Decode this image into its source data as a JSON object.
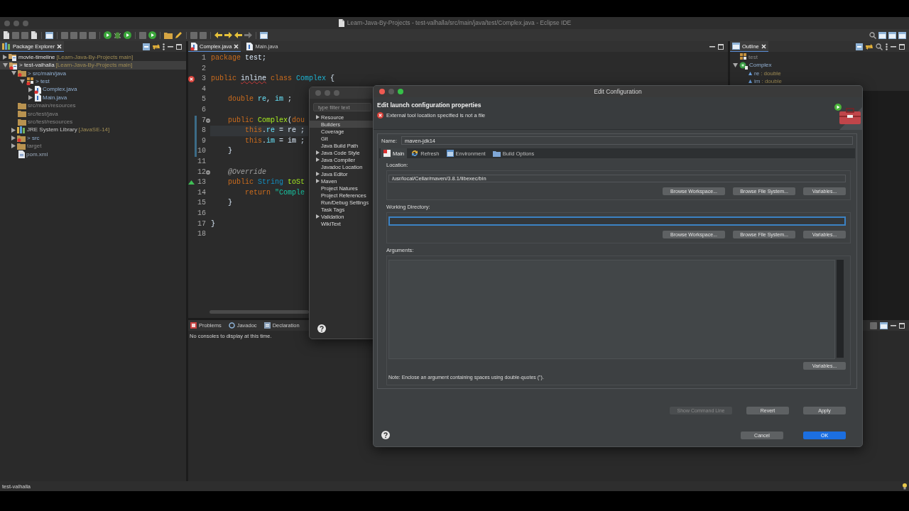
{
  "window": {
    "title": "Learn-Java-By-Projects - test-valhalla/src/main/java/test/Complex.java - Eclipse IDE"
  },
  "package_explorer": {
    "tab": {
      "label": "Package Explorer",
      "selected": true
    },
    "items": [
      {
        "label": "movie-timeline",
        "decoration": "[Learn-Java-By-Projects main]",
        "kind": "project",
        "expanded": false,
        "selected": false,
        "error": false
      },
      {
        "label": "> test-valhalla",
        "decoration": "[Learn-Java-By-Projects main]",
        "kind": "project",
        "expanded": true,
        "selected": true,
        "error": true,
        "children": [
          {
            "label": "> src/main/java",
            "kind": "source-folder",
            "expanded": true,
            "selected": false,
            "error": true,
            "children": [
              {
                "label": "> test",
                "kind": "package",
                "expanded": true,
                "selected": false,
                "error": true,
                "children": [
                  {
                    "label": "Complex.java",
                    "kind": "java-file",
                    "expanded": false,
                    "selected": false,
                    "error": true
                  },
                  {
                    "label": "Main.java",
                    "kind": "java-file",
                    "expanded": false,
                    "selected": false,
                    "error": false
                  }
                ]
              }
            ]
          },
          {
            "label": "src/main/resources",
            "kind": "resource-folder",
            "selected": false,
            "error": false
          },
          {
            "label": "src/test/java",
            "kind": "resource-folder",
            "selected": false,
            "error": false
          },
          {
            "label": "src/test/resources",
            "kind": "resource-folder",
            "selected": false,
            "error": false
          },
          {
            "label": "JRE System Library",
            "decoration": "[JavaSE-14]",
            "kind": "library",
            "expanded": false,
            "selected": false,
            "error": false
          },
          {
            "label": "> src",
            "kind": "source-folder",
            "expanded": false,
            "selected": false,
            "error": true
          },
          {
            "label": "target",
            "kind": "resource-folder",
            "expanded": false,
            "selected": false,
            "error": false
          },
          {
            "label": "pom.xml",
            "kind": "xml-file",
            "selected": false,
            "error": false
          }
        ]
      }
    ]
  },
  "editor": {
    "tabs": [
      {
        "label": "Complex.java",
        "selected": true,
        "error": true
      },
      {
        "label": "Main.java",
        "selected": false,
        "error": false
      }
    ],
    "lines": [
      {
        "number": "1",
        "tokens": [
          {
            "text": "package",
            "kind": "keyword"
          },
          {
            "text": " test;",
            "kind": "plain"
          }
        ]
      },
      {
        "number": "2"
      },
      {
        "number": "3",
        "error_marker": true,
        "tokens": [
          {
            "text": "public ",
            "kind": "keyword"
          },
          {
            "text": "inline",
            "kind": "plain",
            "error": true
          },
          {
            "text": " class ",
            "kind": "keyword"
          },
          {
            "text": "Complex",
            "kind": "type"
          },
          {
            "text": " {",
            "kind": "plain"
          }
        ]
      },
      {
        "number": "4"
      },
      {
        "number": "5",
        "tokens": [
          {
            "text": "    double ",
            "kind": "keyword"
          },
          {
            "text": "re",
            "kind": "field"
          },
          {
            "text": ", ",
            "kind": "plain"
          },
          {
            "text": "im",
            "kind": "field"
          },
          {
            "text": " ;",
            "kind": "plain"
          }
        ]
      },
      {
        "number": "6"
      },
      {
        "number": "7",
        "fold_marker": true,
        "changed": true,
        "tokens": [
          {
            "text": "    public ",
            "kind": "keyword"
          },
          {
            "text": "Complex",
            "kind": "method"
          },
          {
            "text": "(",
            "kind": "plain"
          },
          {
            "text": "dou",
            "kind": "keyword"
          }
        ]
      },
      {
        "number": "8",
        "changed": true,
        "current": true,
        "tokens": [
          {
            "text": "        this",
            "kind": "keyword"
          },
          {
            "text": ".",
            "kind": "plain"
          },
          {
            "text": "re",
            "kind": "field"
          },
          {
            "text": " = re ;",
            "kind": "plain"
          }
        ]
      },
      {
        "number": "9",
        "changed": true,
        "tokens": [
          {
            "text": "        this",
            "kind": "keyword"
          },
          {
            "text": ".",
            "kind": "plain"
          },
          {
            "text": "im",
            "kind": "field"
          },
          {
            "text": " = im ;",
            "kind": "plain"
          }
        ]
      },
      {
        "number": "10",
        "changed": true,
        "tokens": [
          {
            "text": "    }",
            "kind": "plain"
          }
        ]
      },
      {
        "number": "11"
      },
      {
        "number": "12",
        "fold_marker": true,
        "tokens": [
          {
            "text": "    @Override",
            "kind": "annotation"
          }
        ]
      },
      {
        "number": "13",
        "override_marker": true,
        "tokens": [
          {
            "text": "    public ",
            "kind": "keyword"
          },
          {
            "text": "String ",
            "kind": "class"
          },
          {
            "text": "toSt",
            "kind": "method"
          }
        ]
      },
      {
        "number": "14",
        "tokens": [
          {
            "text": "        return ",
            "kind": "keyword"
          },
          {
            "text": "\"Comple",
            "kind": "string"
          }
        ]
      },
      {
        "number": "15",
        "tokens": [
          {
            "text": "    }",
            "kind": "plain"
          }
        ]
      },
      {
        "number": "16"
      },
      {
        "number": "17",
        "tokens": [
          {
            "text": "}",
            "kind": "plain"
          }
        ]
      },
      {
        "number": "18"
      }
    ]
  },
  "outline": {
    "tab": {
      "label": "Outline"
    },
    "items": [
      {
        "label": "test",
        "kind": "package"
      },
      {
        "label": "Complex",
        "kind": "class",
        "expanded": true,
        "children": [
          {
            "label": "re",
            "type": " : double",
            "kind": "field"
          },
          {
            "label": "im",
            "type": " : double",
            "kind": "field"
          }
        ]
      }
    ]
  },
  "bottom_panel": {
    "tabs": [
      {
        "label": "Problems",
        "selected": false,
        "kind": "problems"
      },
      {
        "label": "Javadoc",
        "selected": false,
        "kind": "javadoc"
      },
      {
        "label": "Declaration",
        "selected": false,
        "kind": "declaration"
      }
    ],
    "message": "No consoles to display at this time."
  },
  "status_bar": {
    "text": "test-valhalla"
  },
  "properties_dialog": {
    "filter_placeholder": "type filter text",
    "items": [
      {
        "label": "Resource",
        "expanded": false,
        "selected": false
      },
      {
        "label": "Builders",
        "selected": true
      },
      {
        "label": "Coverage",
        "selected": false
      },
      {
        "label": "Git",
        "selected": false
      },
      {
        "label": "Java Build Path",
        "selected": false
      },
      {
        "label": "Java Code Style",
        "expanded": false,
        "selected": false
      },
      {
        "label": "Java Compiler",
        "expanded": false,
        "selected": false
      },
      {
        "label": "Javadoc Location",
        "selected": false
      },
      {
        "label": "Java Editor",
        "expanded": false,
        "selected": false
      },
      {
        "label": "Maven",
        "expanded": false,
        "selected": false
      },
      {
        "label": "Project Natures",
        "selected": false
      },
      {
        "label": "Project References",
        "selected": false
      },
      {
        "label": "Run/Debug Settings",
        "selected": false
      },
      {
        "label": "Task Tags",
        "selected": false
      },
      {
        "label": "Validation",
        "expanded": false,
        "selected": false
      },
      {
        "label": "WikiText",
        "selected": false
      }
    ]
  },
  "edit_configuration": {
    "title": "Edit Configuration",
    "heading": "Edit launch configuration properties",
    "error": "External tool location specified is not a file",
    "name_label": "Name:",
    "name_value": "maven-jdk14",
    "tabs": [
      {
        "label": "Main",
        "selected": true,
        "kind": "main"
      },
      {
        "label": "Refresh",
        "selected": false,
        "kind": "refresh"
      },
      {
        "label": "Environment",
        "selected": false,
        "kind": "environment"
      },
      {
        "label": "Build Options",
        "selected": false,
        "kind": "build"
      }
    ],
    "location": {
      "label": "Location:",
      "value": "/usr/local/Cellar/maven/3.8.1/libexec/bin",
      "focused": false,
      "buttons": [
        "Browse Workspace...",
        "Browse File System...",
        "Variables..."
      ]
    },
    "working_directory": {
      "label": "Working Directory:",
      "focused": true,
      "buttons": [
        "Browse Workspace...",
        "Browse File System...",
        "Variables..."
      ]
    },
    "arguments": {
      "label": "Arguments:",
      "buttons": [
        "Variables..."
      ],
      "note": "Note: Enclose an argument containing spaces using double-quotes (\")."
    },
    "actions": [
      {
        "label": "Show Command Line",
        "disabled": true
      },
      {
        "label": "Revert",
        "disabled": false
      },
      {
        "label": "Apply",
        "disabled": false
      }
    ],
    "footer_buttons": [
      {
        "label": "Cancel",
        "primary": false
      },
      {
        "label": "OK",
        "primary": true
      }
    ]
  }
}
